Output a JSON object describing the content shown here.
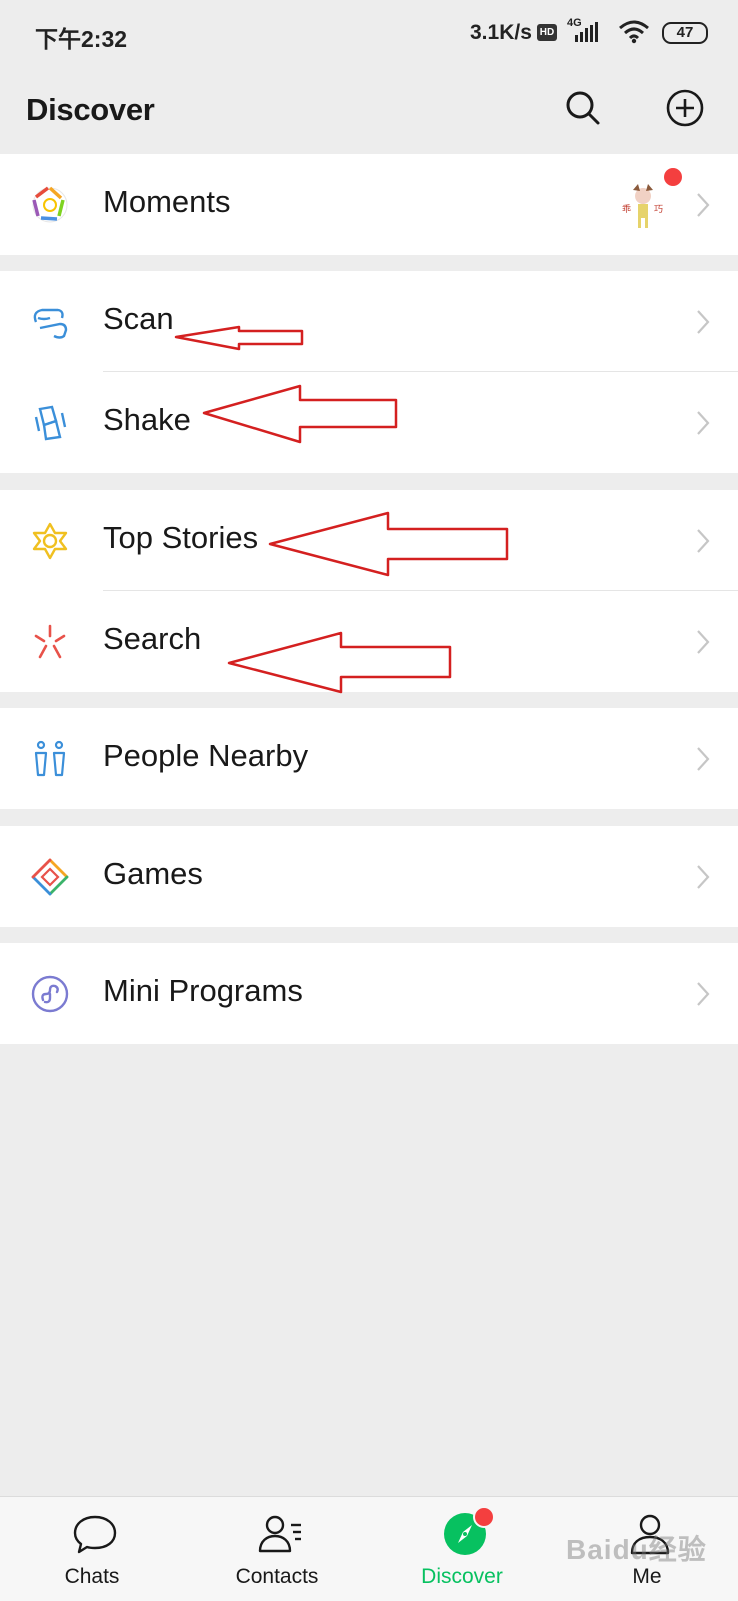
{
  "status_bar": {
    "time": "下午2:32",
    "network_speed": "3.1K/s",
    "hd_badge": "HD",
    "network_type": "4G",
    "battery": "47"
  },
  "header": {
    "title": "Discover",
    "search_icon": "search-icon",
    "add_icon": "plus-circle-icon"
  },
  "groups": [
    {
      "items": [
        {
          "label": "Moments",
          "icon": "moments-aperture-icon",
          "has_unread_dot": true
        }
      ]
    },
    {
      "items": [
        {
          "label": "Scan",
          "icon": "scan-icon"
        },
        {
          "label": "Shake",
          "icon": "shake-icon"
        }
      ]
    },
    {
      "items": [
        {
          "label": "Top Stories",
          "icon": "top-stories-icon"
        },
        {
          "label": "Search",
          "icon": "search-sparkle-icon"
        }
      ]
    },
    {
      "items": [
        {
          "label": "People Nearby",
          "icon": "people-nearby-icon"
        }
      ]
    },
    {
      "items": [
        {
          "label": "Games",
          "icon": "games-icon"
        }
      ]
    },
    {
      "items": [
        {
          "label": "Mini Programs",
          "icon": "mini-programs-icon"
        }
      ]
    }
  ],
  "tabbar": {
    "tabs": [
      {
        "label": "Chats",
        "icon": "chat-bubble-icon",
        "active": false
      },
      {
        "label": "Contacts",
        "icon": "contacts-icon",
        "active": false
      },
      {
        "label": "Discover",
        "icon": "compass-icon",
        "active": true,
        "has_unread_dot": true
      },
      {
        "label": "Me",
        "icon": "person-icon",
        "active": false
      }
    ]
  },
  "colors": {
    "background": "#ededed",
    "accent_green": "#07c160",
    "badge_red": "#f43f3f",
    "annotation_arrow": "#d42020"
  },
  "watermark": "Baidu经验"
}
